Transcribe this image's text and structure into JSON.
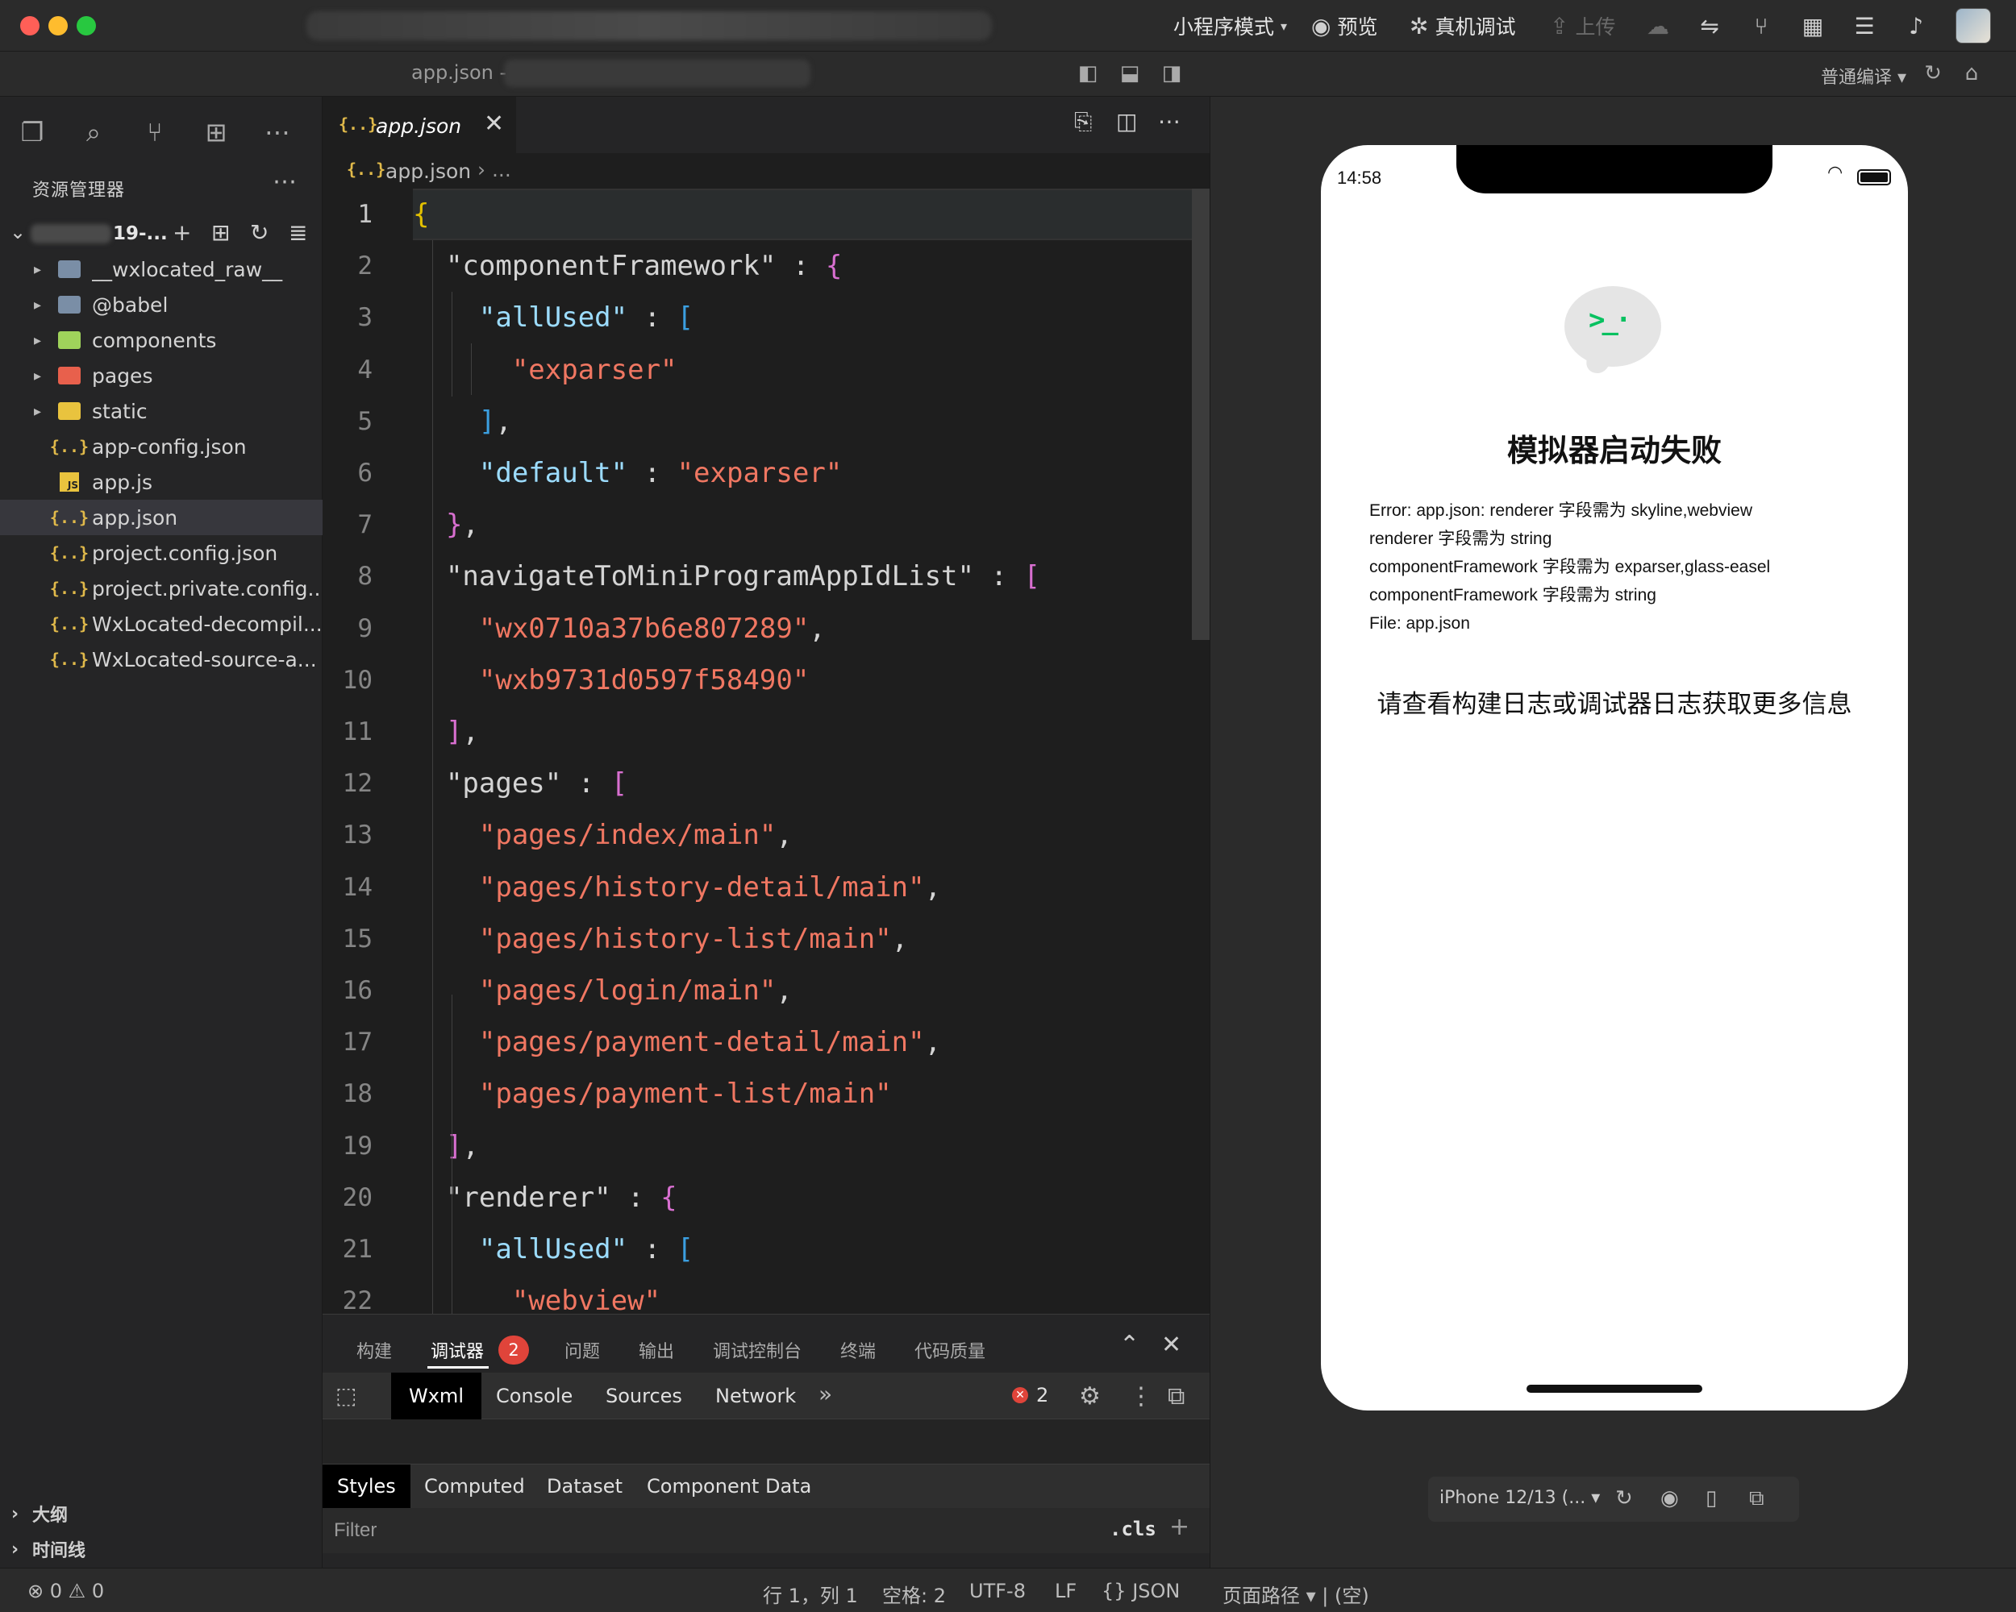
{
  "titlebar": {
    "mode_label": "小程序模式",
    "preview_label": "预览",
    "debug_label": "真机调试",
    "upload_label": "上传"
  },
  "subbar": {
    "file_title": "app.json -",
    "compile_mode": "普通编译"
  },
  "sidebar": {
    "explorer_title": "资源管理器",
    "project_name": "19-...",
    "tree": [
      {
        "label": "__wxlocated_raw__",
        "type": "folder",
        "color": "#7a8ea6",
        "expandable": true
      },
      {
        "label": "@babel",
        "type": "folder",
        "color": "#7a8ea6",
        "expandable": true
      },
      {
        "label": "components",
        "type": "folder",
        "color": "#9fd35b",
        "expandable": true
      },
      {
        "label": "pages",
        "type": "folder",
        "color": "#e8604c",
        "expandable": true
      },
      {
        "label": "static",
        "type": "folder",
        "color": "#e9c33e",
        "expandable": true
      },
      {
        "label": "app-config.json",
        "type": "json"
      },
      {
        "label": "app.js",
        "type": "js"
      },
      {
        "label": "app.json",
        "type": "json",
        "selected": true
      },
      {
        "label": "project.config.json",
        "type": "json"
      },
      {
        "label": "project.private.config....",
        "type": "json"
      },
      {
        "label": "WxLocated-decompil...",
        "type": "json"
      },
      {
        "label": "WxLocated-source-a...",
        "type": "json"
      }
    ],
    "outline_label": "大纲",
    "timeline_label": "时间线"
  },
  "editor": {
    "tab_label": "app.json",
    "breadcrumb_file": "app.json",
    "breadcrumb_rest": "...",
    "json_icon": "{..}",
    "lines": [
      "{",
      "  \"componentFramework\" : {",
      "    \"allUsed\" : [",
      "      \"exparser\"",
      "    ],",
      "    \"default\" : \"exparser\"",
      "  },",
      "  \"navigateToMiniProgramAppIdList\" : [",
      "    \"wx0710a37b6e807289\",",
      "    \"wxb9731d0597f58490\"",
      "  ],",
      "  \"pages\" : [",
      "    \"pages/index/main\",",
      "    \"pages/history-detail/main\",",
      "    \"pages/history-list/main\",",
      "    \"pages/login/main\",",
      "    \"pages/payment-detail/main\",",
      "    \"pages/payment-list/main\"",
      "  ],",
      "  \"renderer\" : {",
      "    \"allUsed\" : [",
      "      \"webview\""
    ]
  },
  "panel": {
    "tabs": [
      "构建",
      "调试器",
      "问题",
      "输出",
      "调试控制台",
      "终端",
      "代码质量"
    ],
    "active_tab": "调试器",
    "badge": "2",
    "devtools_tabs": [
      "Wxml",
      "Console",
      "Sources",
      "Network"
    ],
    "error_count": "2",
    "style_tabs": [
      "Styles",
      "Computed",
      "Dataset",
      "Component Data"
    ],
    "filter_placeholder": "Filter",
    "cls_label": ".cls"
  },
  "simulator": {
    "time": "14:58",
    "error_title": "模拟器启动失败",
    "error_lines": [
      "Error: app.json: renderer 字段需为 skyline,webview",
      "renderer 字段需为 string",
      "componentFramework 字段需为 exparser,glass-easel",
      "componentFramework 字段需为 string",
      "File: app.json"
    ],
    "hint": "请查看构建日志或调试器日志获取更多信息",
    "device": "iPhone 12/13 (..."
  },
  "statusbar": {
    "errors": "0",
    "warnings": "0",
    "position": "行 1，列 1",
    "spaces": "空格: 2",
    "encoding": "UTF-8",
    "eol": "LF",
    "language": "JSON",
    "page_path_label": "页面路径",
    "page_path_value": "(空)"
  }
}
